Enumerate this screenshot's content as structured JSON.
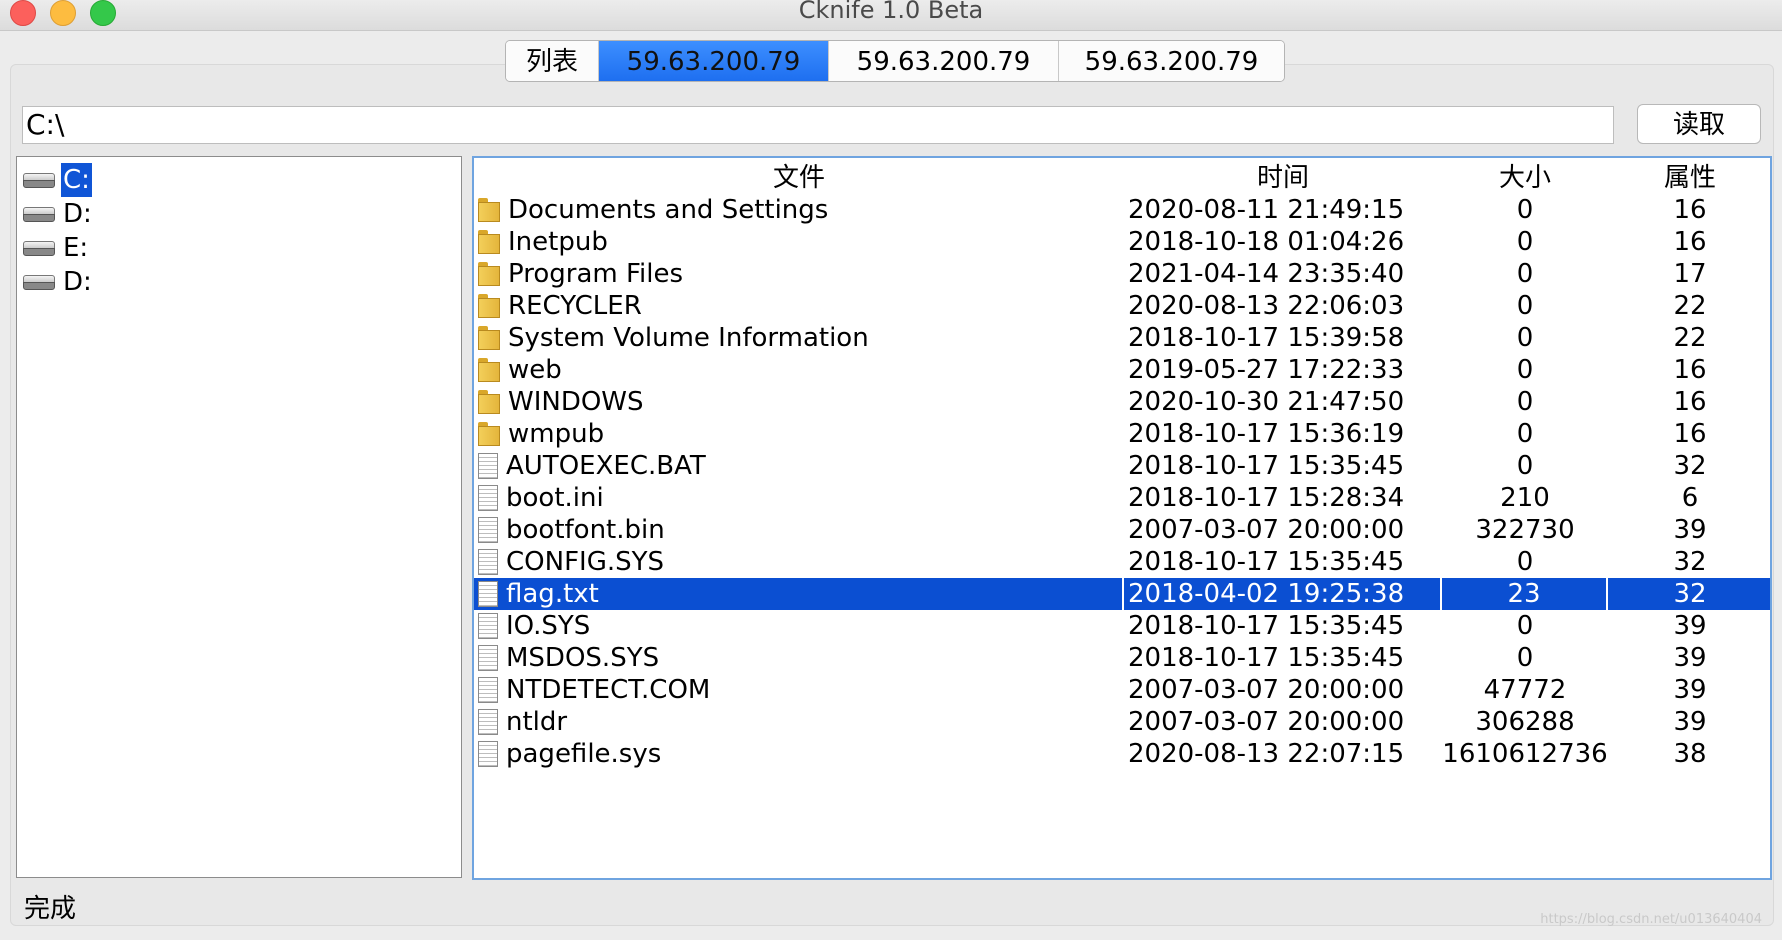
{
  "window": {
    "title": "Cknife 1.0 Beta"
  },
  "tabs": [
    {
      "label": "列表",
      "active": false
    },
    {
      "label": "59.63.200.79",
      "active": true
    },
    {
      "label": "59.63.200.79",
      "active": false
    },
    {
      "label": "59.63.200.79",
      "active": false
    }
  ],
  "path_bar": {
    "value": "C:\\",
    "read_label": "读取"
  },
  "tree": {
    "items": [
      {
        "label": "C:",
        "selected": true,
        "icon": "drive-icon"
      },
      {
        "label": "D:",
        "selected": false,
        "icon": "drive-icon"
      },
      {
        "label": "E:",
        "selected": false,
        "icon": "drive-icon"
      },
      {
        "label": "D:",
        "selected": false,
        "icon": "drive-icon"
      }
    ]
  },
  "table": {
    "headers": {
      "name": "文件",
      "time": "时间",
      "size": "大小",
      "attr": "属性"
    },
    "rows": [
      {
        "type": "folder",
        "name": "Documents and Settings",
        "time": "2020-08-11 21:49:15",
        "size": "0",
        "attr": "16"
      },
      {
        "type": "folder",
        "name": "Inetpub",
        "time": "2018-10-18 01:04:26",
        "size": "0",
        "attr": "16"
      },
      {
        "type": "folder",
        "name": "Program Files",
        "time": "2021-04-14 23:35:40",
        "size": "0",
        "attr": "17"
      },
      {
        "type": "folder",
        "name": "RECYCLER",
        "time": "2020-08-13 22:06:03",
        "size": "0",
        "attr": "22"
      },
      {
        "type": "folder",
        "name": "System Volume Information",
        "time": "2018-10-17 15:39:58",
        "size": "0",
        "attr": "22"
      },
      {
        "type": "folder",
        "name": "web",
        "time": "2019-05-27 17:22:33",
        "size": "0",
        "attr": "16"
      },
      {
        "type": "folder",
        "name": "WINDOWS",
        "time": "2020-10-30 21:47:50",
        "size": "0",
        "attr": "16"
      },
      {
        "type": "folder",
        "name": "wmpub",
        "time": "2018-10-17 15:36:19",
        "size": "0",
        "attr": "16"
      },
      {
        "type": "file",
        "name": "AUTOEXEC.BAT",
        "time": "2018-10-17 15:35:45",
        "size": "0",
        "attr": "32"
      },
      {
        "type": "file",
        "name": "boot.ini",
        "time": "2018-10-17 15:28:34",
        "size": "210",
        "attr": "6"
      },
      {
        "type": "file",
        "name": "bootfont.bin",
        "time": "2007-03-07 20:00:00",
        "size": "322730",
        "attr": "39"
      },
      {
        "type": "file",
        "name": "CONFIG.SYS",
        "time": "2018-10-17 15:35:45",
        "size": "0",
        "attr": "32"
      },
      {
        "type": "file",
        "name": "flag.txt",
        "time": "2018-04-02 19:25:38",
        "size": "23",
        "attr": "32",
        "selected": true
      },
      {
        "type": "file",
        "name": "IO.SYS",
        "time": "2018-10-17 15:35:45",
        "size": "0",
        "attr": "39"
      },
      {
        "type": "file",
        "name": "MSDOS.SYS",
        "time": "2018-10-17 15:35:45",
        "size": "0",
        "attr": "39"
      },
      {
        "type": "file",
        "name": "NTDETECT.COM",
        "time": "2007-03-07 20:00:00",
        "size": "47772",
        "attr": "39"
      },
      {
        "type": "file",
        "name": "ntldr",
        "time": "2007-03-07 20:00:00",
        "size": "306288",
        "attr": "39"
      },
      {
        "type": "file",
        "name": "pagefile.sys",
        "time": "2020-08-13 22:07:15",
        "size": "1610612736",
        "attr": "38"
      }
    ]
  },
  "status": {
    "text": "完成"
  },
  "watermark": "https://blog.csdn.net/u013640404",
  "colors": {
    "selection": "#0b4fd2",
    "tab_active": "#1e6ff0"
  }
}
